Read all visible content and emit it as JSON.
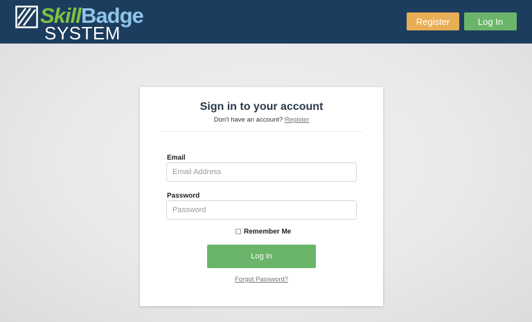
{
  "header": {
    "logo": {
      "word1": "Skill",
      "word2": "Badge",
      "word3": "SYSTEM",
      "icon": "logo-mark-icon"
    },
    "register_label": "Register",
    "login_label": "Log In"
  },
  "card": {
    "title": "Sign in to your account",
    "subtitle_prefix": "Don't have an account? ",
    "subtitle_link": "Register",
    "email_label": "Email",
    "email_placeholder": "Email Address",
    "email_value": "",
    "password_label": "Password",
    "password_placeholder": "Password",
    "password_value": "",
    "remember_label": "Remember Me",
    "remember_checked": false,
    "submit_label": "Log In",
    "forgot_label": "Forgot Password?"
  },
  "colors": {
    "navbar": "#1c3d5e",
    "register_button": "#e8ae56",
    "login_button": "#6bb56a",
    "logo_skill": "#7dc142",
    "logo_badge": "#8ec4e8"
  }
}
